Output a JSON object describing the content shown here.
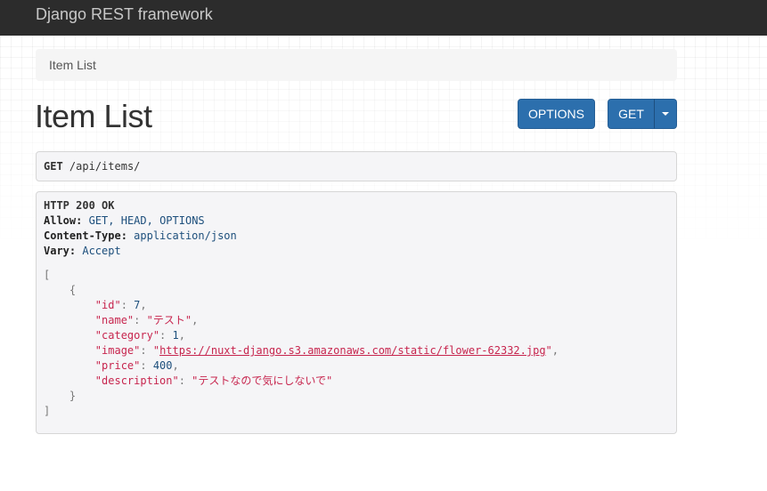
{
  "navbar": {
    "brand": "Django REST framework"
  },
  "breadcrumb": {
    "items": [
      "Item List"
    ]
  },
  "page": {
    "title": "Item List"
  },
  "buttons": {
    "options": "OPTIONS",
    "get": "GET"
  },
  "request": {
    "method": "GET",
    "path": "/api/items/"
  },
  "response": {
    "status": "HTTP 200 OK",
    "headers": [
      {
        "key": "Allow:",
        "value": "GET, HEAD, OPTIONS"
      },
      {
        "key": "Content-Type:",
        "value": "application/json"
      },
      {
        "key": "Vary:",
        "value": "Accept"
      }
    ],
    "body": {
      "open_bracket": "[",
      "open_brace": "{",
      "fields": [
        {
          "key": "\"id\"",
          "value": "7",
          "type": "number",
          "comma": ","
        },
        {
          "key": "\"name\"",
          "value": "\"テスト\"",
          "type": "string",
          "comma": ","
        },
        {
          "key": "\"category\"",
          "value": "1",
          "type": "number",
          "comma": ","
        },
        {
          "key": "\"image\"",
          "value": "https://nuxt-django.s3.amazonaws.com/static/flower-62332.jpg",
          "type": "url",
          "comma": ","
        },
        {
          "key": "\"price\"",
          "value": "400",
          "type": "number",
          "comma": ","
        },
        {
          "key": "\"description\"",
          "value": "\"テストなので気にしないで\"",
          "type": "string",
          "comma": ""
        }
      ],
      "close_brace": "}",
      "close_bracket": "]"
    }
  }
}
